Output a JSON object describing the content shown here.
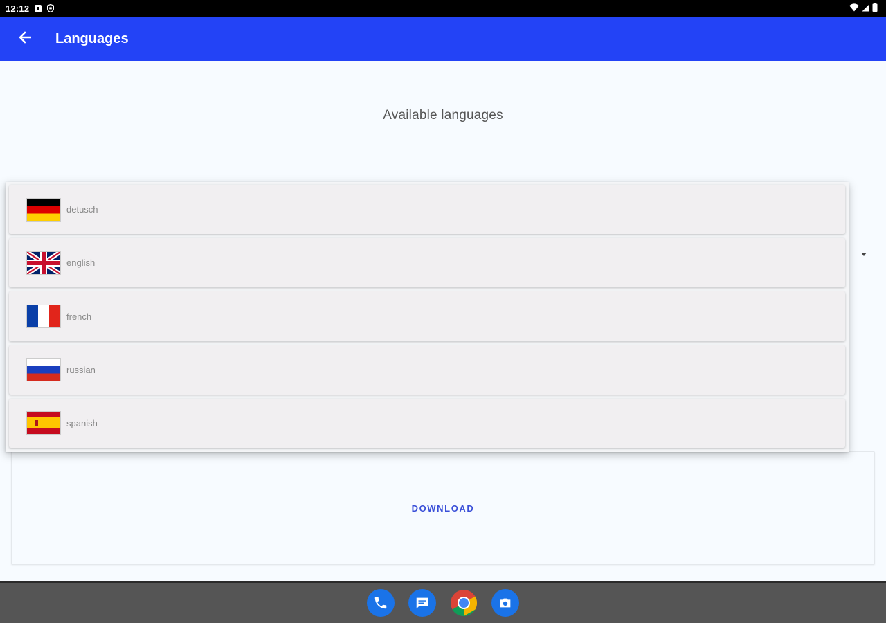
{
  "status_bar": {
    "time": "12:12"
  },
  "app_bar": {
    "title": "Languages",
    "background": "#2343f6"
  },
  "page": {
    "section_title": "Available languages"
  },
  "languages": [
    {
      "label": "detusch",
      "flag_icon": "germany-flag-icon"
    },
    {
      "label": "english",
      "flag_icon": "uk-flag-icon"
    },
    {
      "label": "french",
      "flag_icon": "france-flag-icon"
    },
    {
      "label": "russian",
      "flag_icon": "russia-flag-icon"
    },
    {
      "label": "spanish",
      "flag_icon": "spain-flag-icon"
    }
  ],
  "download": {
    "label": "DOWNLOAD",
    "color": "#3a4fd8"
  },
  "dock": {
    "apps": [
      "phone-icon",
      "messages-icon",
      "chrome-icon",
      "camera-icon"
    ]
  }
}
